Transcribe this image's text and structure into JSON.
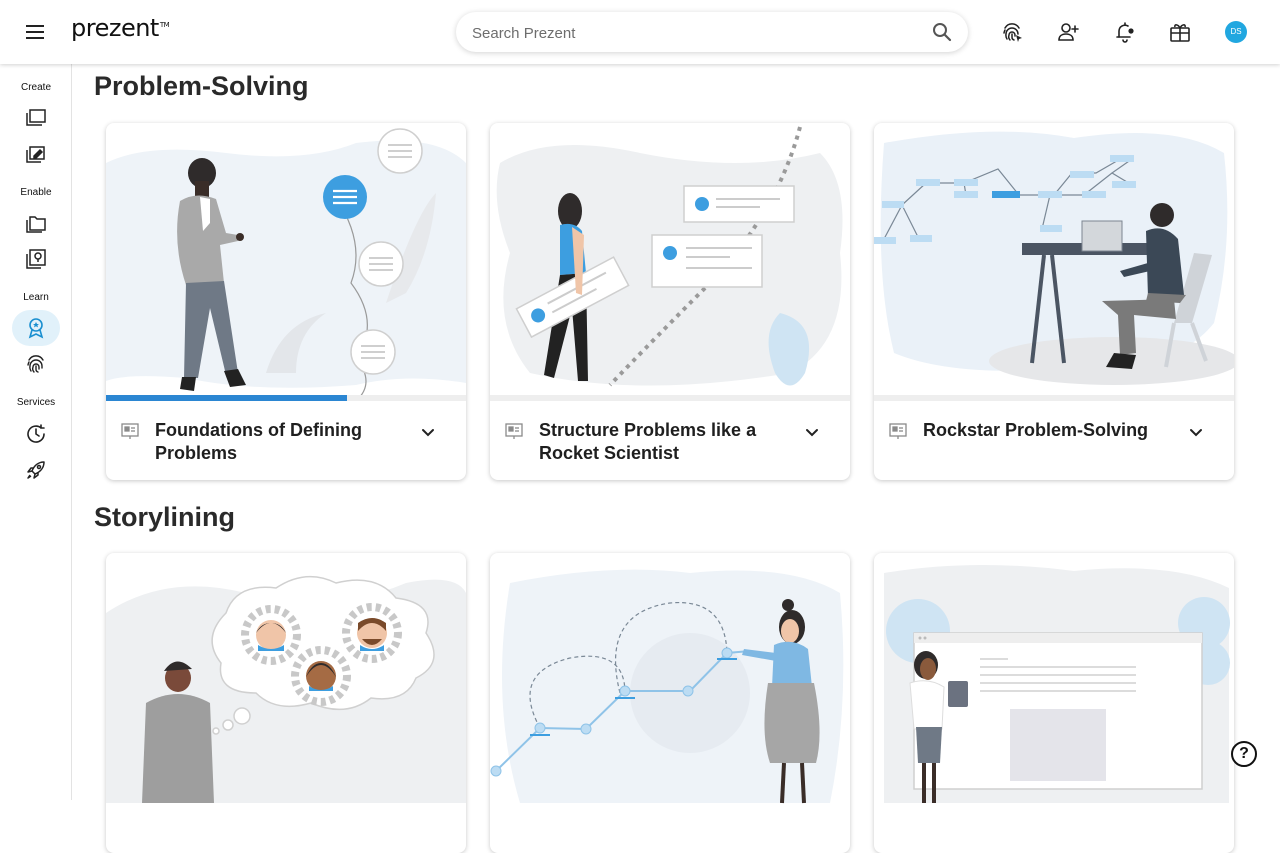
{
  "header": {
    "logo_text": "prezent",
    "logo_tm": "TM",
    "search_placeholder": "Search Prezent",
    "avatar_initials": "DS"
  },
  "sidebar": {
    "sections": [
      {
        "label": "Create"
      },
      {
        "label": "Enable"
      },
      {
        "label": "Learn"
      },
      {
        "label": "Services"
      }
    ],
    "active_item": "learn-courses",
    "accent_color": "#21a7e0"
  },
  "sections": [
    {
      "title": "Problem-Solving",
      "cards": [
        {
          "title": "Foundations of Defining Problems",
          "progress": 0.67
        },
        {
          "title": "Structure Problems like a Rocket Scientist",
          "progress": 0
        },
        {
          "title": "Rockstar Problem-Solving",
          "progress": 0
        }
      ]
    },
    {
      "title": "Storylining",
      "cards": [
        {
          "title": ""
        },
        {
          "title": ""
        },
        {
          "title": ""
        }
      ]
    }
  ],
  "help_label": "?"
}
